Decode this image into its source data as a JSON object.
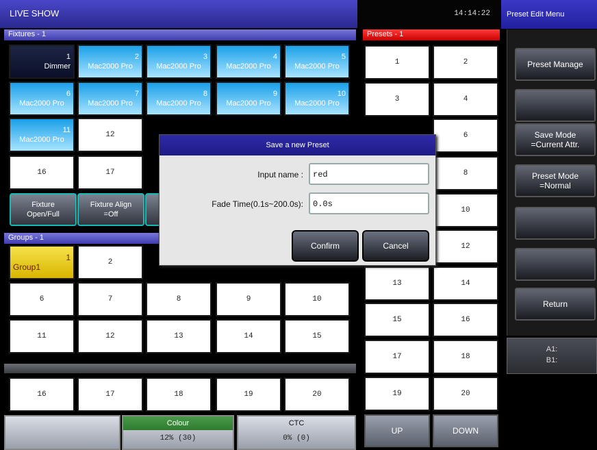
{
  "header": {
    "title": "LIVE SHOW",
    "clock": "14:14:22",
    "menu_title": "Preset Edit Menu"
  },
  "fixtures": {
    "section_label": "Fixtures - 1",
    "items": [
      {
        "num": "1",
        "label": "Dimmer",
        "style": "dark"
      },
      {
        "num": "2",
        "label": "Mac2000 Pro",
        "style": "blue"
      },
      {
        "num": "3",
        "label": "Mac2000 Pro",
        "style": "blue"
      },
      {
        "num": "4",
        "label": "Mac2000 Pro",
        "style": "blue"
      },
      {
        "num": "5",
        "label": "Mac2000 Pro",
        "style": "blue"
      },
      {
        "num": "6",
        "label": "Mac2000 Pro",
        "style": "blue"
      },
      {
        "num": "7",
        "label": "Mac2000 Pro",
        "style": "blue"
      },
      {
        "num": "8",
        "label": "Mac2000 Pro",
        "style": "blue"
      },
      {
        "num": "9",
        "label": "Mac2000 Pro",
        "style": "blue"
      },
      {
        "num": "10",
        "label": "Mac2000 Pro",
        "style": "blue"
      },
      {
        "num": "11",
        "label": "Mac2000 Pro",
        "style": "blue"
      },
      {
        "num": "12",
        "label": "",
        "style": "white"
      },
      {
        "num": "16",
        "label": "",
        "style": "white"
      },
      {
        "num": "17",
        "label": "",
        "style": "white"
      }
    ],
    "buttons": [
      {
        "line1": "Fixture",
        "line2": "Open/Full"
      },
      {
        "line1": "Fixture Align",
        "line2": "=Off"
      }
    ]
  },
  "groups": {
    "section_label": "Groups - 1",
    "group1": {
      "num": "1",
      "label": "Group1"
    },
    "cells": [
      "2",
      "6",
      "7",
      "8",
      "9",
      "10",
      "11",
      "12",
      "13",
      "14",
      "15",
      "16",
      "17",
      "18",
      "19",
      "20"
    ]
  },
  "bottom": {
    "colour_label": "Colour",
    "colour_value": "12% (30)",
    "ctc_label": "CTC",
    "ctc_value": "0% (0)"
  },
  "presets": {
    "section_label": "Presets - 1",
    "cells": [
      "1",
      "2",
      "3",
      "4",
      "6",
      "8",
      "10",
      "12",
      "13",
      "14",
      "15",
      "16",
      "17",
      "18",
      "19",
      "20"
    ],
    "up_label": "UP",
    "down_label": "DOWN"
  },
  "side_menu": {
    "preset_manage": "Preset Manage",
    "save_mode": [
      "Save Mode",
      "=Current Attr."
    ],
    "preset_mode": [
      "Preset Mode",
      "=Normal"
    ],
    "return": "Return",
    "a1": "A1:",
    "b1": "B1:"
  },
  "dialog": {
    "title": "Save a new Preset",
    "name_label": "Input name :",
    "name_value": "red",
    "fade_label": "Fade Time(0.1s~200.0s):",
    "fade_value": "0.0s",
    "confirm": "Confirm",
    "cancel": "Cancel"
  },
  "colors": {
    "accent_blue": "#2e2aa6",
    "preset_red": "#e00000",
    "group_yellow": "#f2d230",
    "fixture_blue": "#1aa0e8"
  }
}
